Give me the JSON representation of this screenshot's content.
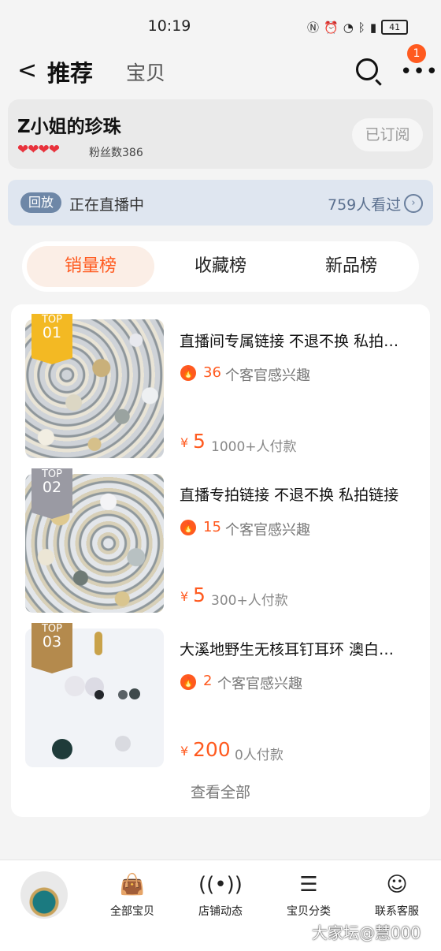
{
  "status": {
    "time": "10:19",
    "battery": "41"
  },
  "header": {
    "tab_recommend": "推荐",
    "tab_items": "宝贝",
    "badge": "1"
  },
  "shop": {
    "name": "Z小姐的珍珠",
    "fans": "粉丝数386",
    "subscribe": "已订阅"
  },
  "live": {
    "replay": "回放",
    "status": "正在直播中",
    "viewers": "759人看过"
  },
  "tabs": [
    {
      "label": "销量榜"
    },
    {
      "label": "收藏榜"
    },
    {
      "label": "新品榜"
    }
  ],
  "items": [
    {
      "rank_top": "TOP",
      "rank_no": "01",
      "title": "直播间专属链接 不退不换 私拍链接",
      "interest_count": "36",
      "interest_text": "个客官感兴趣",
      "currency": "¥",
      "price": "5",
      "paid": "1000+人付款"
    },
    {
      "rank_top": "TOP",
      "rank_no": "02",
      "title": "直播专拍链接 不退不换 私拍链接",
      "interest_count": "15",
      "interest_text": "个客官感兴趣",
      "currency": "¥",
      "price": "5",
      "paid": "300+人付款"
    },
    {
      "rank_top": "TOP",
      "rank_no": "03",
      "title": "大溪地野生无核耳钉耳环 澳白耳饰",
      "interest_count": "2",
      "interest_text": "个客官感兴趣",
      "currency": "¥",
      "price": "200",
      "paid": "0人付款"
    }
  ],
  "view_all": "查看全部",
  "bottom_nav": [
    {
      "label": "全部宝贝",
      "icon": "bag-icon"
    },
    {
      "label": "店铺动态",
      "icon": "broadcast-icon"
    },
    {
      "label": "宝贝分类",
      "icon": "list-icon"
    },
    {
      "label": "联系客服",
      "icon": "chat-face-icon"
    }
  ],
  "watermark": "大家坛@慧000",
  "colors": {
    "accent": "#ff5a1f",
    "live_bar": "#dfe6f0"
  }
}
